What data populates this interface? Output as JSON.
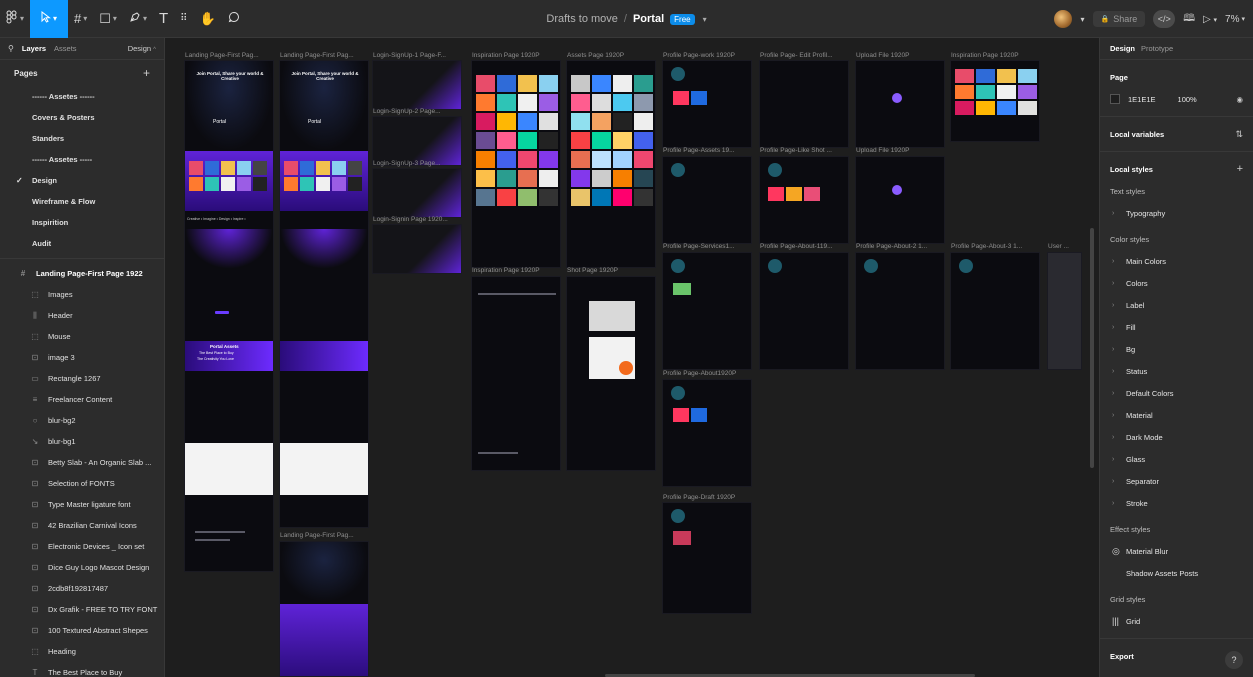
{
  "toolbar": {
    "file_project": "Drafts to move",
    "file_name": "Portal",
    "plan_badge": "Free",
    "share_label": "Share",
    "zoom": "7%"
  },
  "left_panel": {
    "tabs": [
      "Layers",
      "Assets"
    ],
    "page_selector": "Design",
    "pages_title": "Pages",
    "pages": [
      {
        "label": "------ Assetes ------",
        "current": false
      },
      {
        "label": "Covers & Posters",
        "current": false
      },
      {
        "label": "Standers",
        "current": false
      },
      {
        "label": "------ Assetes -----",
        "current": false
      },
      {
        "label": "Design",
        "current": true
      },
      {
        "label": "Wireframe & Flow",
        "current": false
      },
      {
        "label": "Inspirition",
        "current": false
      },
      {
        "label": "Audit",
        "current": false
      }
    ],
    "layers_root": "Landing Page-First Page 1922",
    "layers": [
      {
        "label": "Images",
        "icon": "frame-icon"
      },
      {
        "label": "Header",
        "icon": "autolayout-icon"
      },
      {
        "label": "Mouse",
        "icon": "frame-icon"
      },
      {
        "label": "image 3",
        "icon": "image-icon"
      },
      {
        "label": "Rectangle 1267",
        "icon": "rectangle-icon"
      },
      {
        "label": "Freelancer Content",
        "icon": "autolayout-icon"
      },
      {
        "label": "blur-bg2",
        "icon": "blur-icon"
      },
      {
        "label": "blur-bg1",
        "icon": "vector-icon"
      },
      {
        "label": "Betty Slab - An Organic Slab ...",
        "icon": "image-icon"
      },
      {
        "label": "Selection of FONTS",
        "icon": "image-icon"
      },
      {
        "label": "Type Master ligature font",
        "icon": "image-icon"
      },
      {
        "label": "42 Brazilian Carnival Icons",
        "icon": "image-icon"
      },
      {
        "label": "Electronic Devices _ Icon set",
        "icon": "image-icon"
      },
      {
        "label": "Dice Guy Logo Mascot Design",
        "icon": "image-icon"
      },
      {
        "label": "2cdb8f192817487",
        "icon": "image-icon"
      },
      {
        "label": "Dx Grafik - FREE TO TRY FONT",
        "icon": "image-icon"
      },
      {
        "label": "100 Textured Abstract Shepes",
        "icon": "image-icon"
      },
      {
        "label": "Heading",
        "icon": "frame-icon"
      },
      {
        "label": "The Best Place to Buy",
        "icon": "text-icon"
      }
    ]
  },
  "right_panel": {
    "tabs": [
      "Design",
      "Prototype"
    ],
    "page_title": "Page",
    "page_color": "1E1E1E",
    "page_opacity": "100%",
    "local_variables": "Local variables",
    "local_styles": "Local styles",
    "text_styles_title": "Text styles",
    "text_styles": [
      "Typography"
    ],
    "color_styles_title": "Color styles",
    "color_styles": [
      "Main Colors",
      "Colors",
      "Label",
      "Fill",
      "Bg",
      "Status",
      "Default Colors",
      "Material",
      "Dark Mode",
      "Glass",
      "Separator",
      "Stroke"
    ],
    "effect_styles_title": "Effect styles",
    "effect_styles": [
      "Material Blur",
      "Shadow Assets Posts"
    ],
    "grid_styles_title": "Grid styles",
    "grid_styles": [
      "Grid"
    ],
    "export_label": "Export",
    "help_label": "?"
  },
  "canvas": {
    "frame_labels": [
      "Landing Page-First Pag...",
      "Landing Page-First Pag...",
      "Login-SignUp-1 Page-F...",
      "Inspiration Page 1920P",
      "Assets Page 1920P",
      "Profile Page-work 1920P",
      "Profile Page- Edit Profil...",
      "Upload File 1920P",
      "Inspiration Page 1920P",
      "Login-SignUp-2 Page...",
      "Login-SignUp-3 Page...",
      "Login-Signin Page 1920...",
      "Profile Page-Assets 19...",
      "Profile Page-Like Shot ...",
      "Upload File 1920P",
      "Inspiration Page 1920P",
      "Shot Page 1920P",
      "Profile Page-Services1...",
      "Profile Page-About-119...",
      "Profile Page-About-2 1...",
      "Profile Page-About-3 1...",
      "User ...",
      "Profile Page-About1920P",
      "Profile Page-Draft 1920P",
      "Landing Page-First Pag..."
    ],
    "hero_texts": {
      "join_portal": "Join Portal, Share your world & Creative",
      "portal_logo": "Portal",
      "portal_assets": "Portal Assets",
      "best_place": "The Best Place to Buy",
      "creativity": "The Creativity You Love",
      "ticker": "Creative • Imagine • Design • Inspire •"
    }
  }
}
